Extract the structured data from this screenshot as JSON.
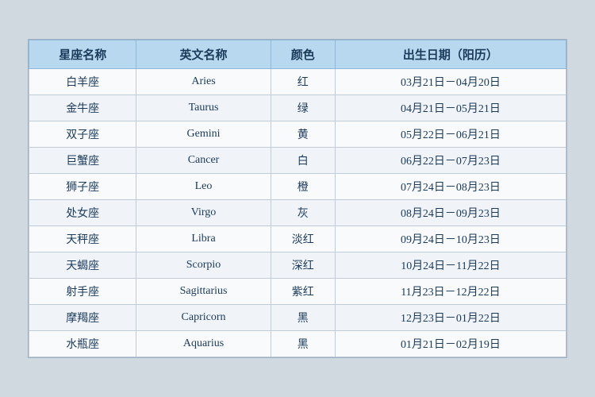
{
  "table": {
    "headers": {
      "col1": "星座名称",
      "col2": "英文名称",
      "col3": "颜色",
      "col4": "出生日期（阳历）"
    },
    "rows": [
      {
        "chinese": "白羊座",
        "english": "Aries",
        "color": "红",
        "date": "03月21日－04月20日"
      },
      {
        "chinese": "金牛座",
        "english": "Taurus",
        "color": "绿",
        "date": "04月21日－05月21日"
      },
      {
        "chinese": "双子座",
        "english": "Gemini",
        "color": "黄",
        "date": "05月22日－06月21日"
      },
      {
        "chinese": "巨蟹座",
        "english": "Cancer",
        "color": "白",
        "date": "06月22日－07月23日"
      },
      {
        "chinese": "狮子座",
        "english": "Leo",
        "color": "橙",
        "date": "07月24日－08月23日"
      },
      {
        "chinese": "处女座",
        "english": "Virgo",
        "color": "灰",
        "date": "08月24日－09月23日"
      },
      {
        "chinese": "天秤座",
        "english": "Libra",
        "color": "淡红",
        "date": "09月24日－10月23日"
      },
      {
        "chinese": "天蝎座",
        "english": "Scorpio",
        "color": "深红",
        "date": "10月24日－11月22日"
      },
      {
        "chinese": "射手座",
        "english": "Sagittarius",
        "color": "紫红",
        "date": "11月23日－12月22日"
      },
      {
        "chinese": "摩羯座",
        "english": "Capricorn",
        "color": "黑",
        "date": "12月23日－01月22日"
      },
      {
        "chinese": "水瓶座",
        "english": "Aquarius",
        "color": "黑",
        "date": "01月21日－02月19日"
      }
    ]
  }
}
